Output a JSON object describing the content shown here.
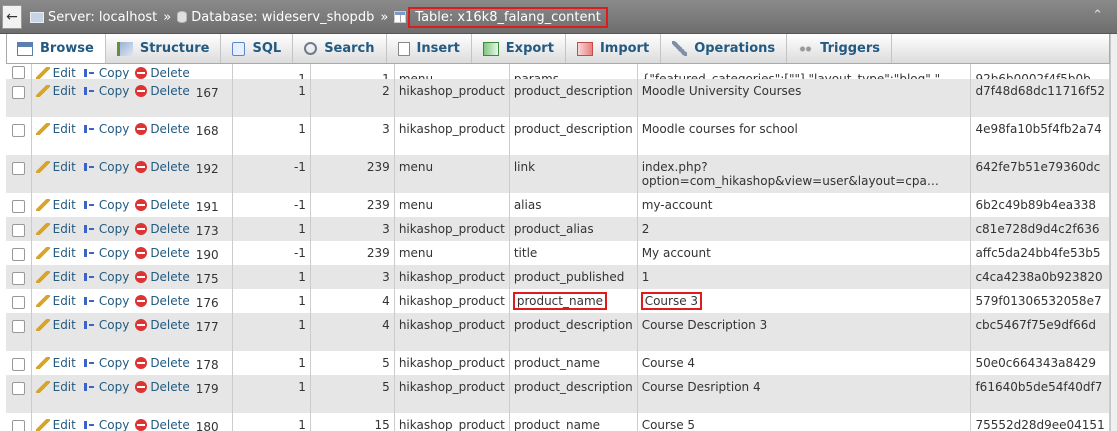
{
  "breadcrumb": {
    "server": "Server: localhost",
    "database": "Database: wideserv_shopdb",
    "table": "Table: x16k8_falang_content",
    "separator": "»"
  },
  "tabs": [
    {
      "label": "Browse",
      "icon": "browse-icon",
      "active": true
    },
    {
      "label": "Structure",
      "icon": "structure-icon"
    },
    {
      "label": "SQL",
      "icon": "sql-icon"
    },
    {
      "label": "Search",
      "icon": "search-icon"
    },
    {
      "label": "Insert",
      "icon": "insert-icon"
    },
    {
      "label": "Export",
      "icon": "export-icon"
    },
    {
      "label": "Import",
      "icon": "import-icon"
    },
    {
      "label": "Operations",
      "icon": "operations-icon"
    },
    {
      "label": "Triggers",
      "icon": "triggers-icon"
    }
  ],
  "actions": {
    "edit": "Edit",
    "copy": "Copy",
    "delete": "Delete"
  },
  "rows": [
    {
      "id": "167",
      "lang": "1",
      "ref": "2",
      "table": "hikashop_product",
      "field": "product_description",
      "value": "Moodle University Courses",
      "value2": "",
      "hash": "d7f48d68dc11716f52"
    },
    {
      "id": "168",
      "lang": "1",
      "ref": "3",
      "table": "hikashop_product",
      "field": "product_description",
      "value": "Moodle courses for school",
      "value2": "",
      "hash": "4e98fa10b5f4fb2a74"
    },
    {
      "id": "192",
      "lang": "-1",
      "ref": "239",
      "table": "menu",
      "field": "link",
      "value": "index.php?",
      "value2": "option=com_hikashop&view=user&layout=cpa…",
      "hash": "642fe7b51e79360dc"
    },
    {
      "id": "191",
      "lang": "-1",
      "ref": "239",
      "table": "menu",
      "field": "alias",
      "value": "my-account",
      "value2": "",
      "hash": "6b2c49b89b4ea338"
    },
    {
      "id": "173",
      "lang": "1",
      "ref": "3",
      "table": "hikashop_product",
      "field": "product_alias",
      "value": "2",
      "value2": "",
      "hash": "c81e728d9d4c2f636"
    },
    {
      "id": "190",
      "lang": "-1",
      "ref": "239",
      "table": "menu",
      "field": "title",
      "value": "My account",
      "value2": "",
      "hash": "affc5da24bb4fe53b5"
    },
    {
      "id": "175",
      "lang": "1",
      "ref": "3",
      "table": "hikashop_product",
      "field": "product_published",
      "value": "1",
      "value2": "",
      "hash": "c4ca4238a0b923820"
    },
    {
      "id": "176",
      "lang": "1",
      "ref": "4",
      "table": "hikashop_product",
      "field": "product_name",
      "value": "Course 3",
      "value2": "",
      "hash": "579f01306532058e7",
      "highlight": true
    },
    {
      "id": "177",
      "lang": "1",
      "ref": "4",
      "table": "hikashop_product",
      "field": "product_description",
      "value": "Course Description 3",
      "value2": "",
      "hash": "cbc5467f75e9df66d"
    },
    {
      "id": "178",
      "lang": "1",
      "ref": "5",
      "table": "hikashop_product",
      "field": "product_name",
      "value": "Course 4",
      "value2": "",
      "hash": "50e0c664343a8429"
    },
    {
      "id": "179",
      "lang": "1",
      "ref": "5",
      "table": "hikashop_product",
      "field": "product_description",
      "value": "Course Desription 4",
      "value2": "",
      "hash": "f61640b5de54f40df7"
    },
    {
      "id": "180",
      "lang": "1",
      "ref": "15",
      "table": "hikashop_product",
      "field": "product_name",
      "value": "Course 5",
      "value2": "",
      "hash": "75552d28d9ee04151"
    }
  ],
  "partial_top_row": {
    "lang": "1",
    "ref": "1",
    "table": "menu",
    "field": "params",
    "value": "{\"featured_categories\":[\"\"],\"layout_type\":\"blog\",\"…",
    "hash": "92b6b0002f4f5b0b"
  }
}
